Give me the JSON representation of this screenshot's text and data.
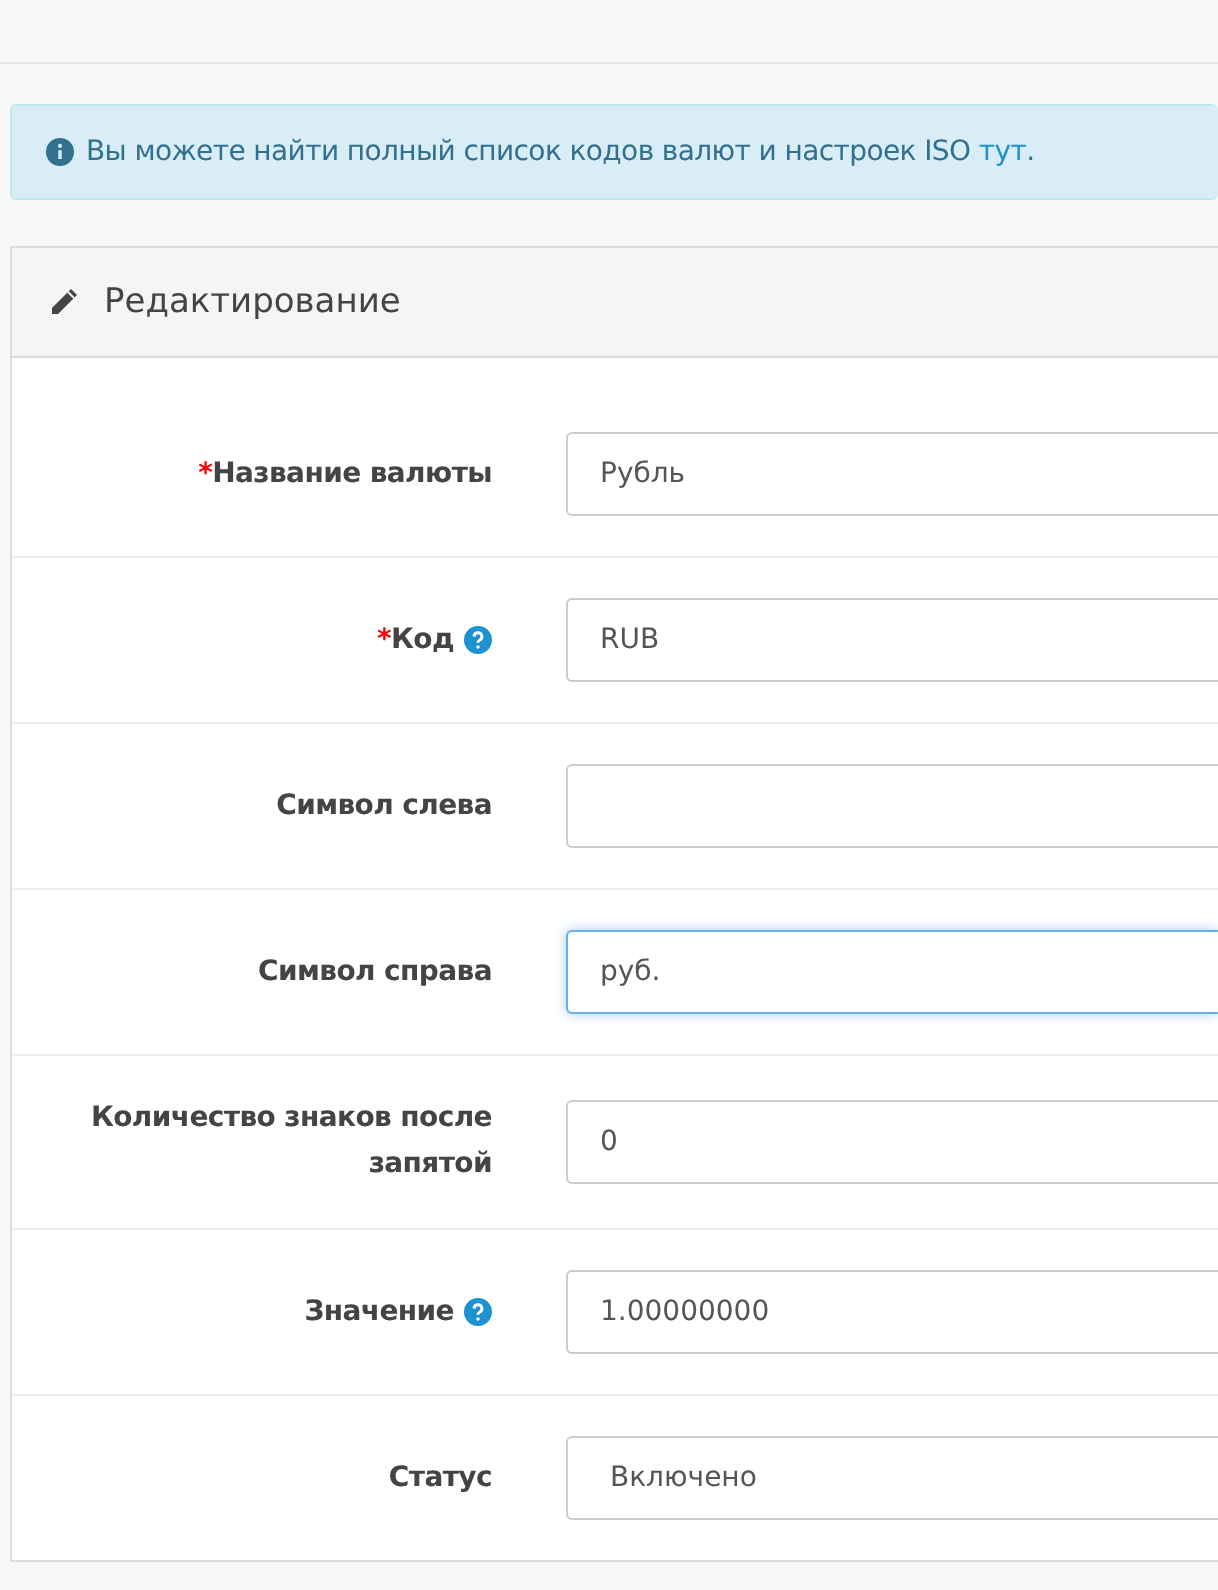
{
  "alert": {
    "text": "Вы можете найти полный список кодов валют и настроек ISO ",
    "link": "тут",
    "end": "."
  },
  "panel": {
    "title": "Редактирование"
  },
  "fields": [
    {
      "label": "Название валюты",
      "required_mark": "*",
      "help": false,
      "kind": "text",
      "value": "Рубль",
      "focused": false
    },
    {
      "label": "Код",
      "required_mark": "*",
      "help": true,
      "kind": "text",
      "value": "RUB",
      "focused": false
    },
    {
      "label": "Символ слева",
      "help": false,
      "kind": "text",
      "focused": false
    },
    {
      "label": "Символ справа",
      "help": false,
      "kind": "text",
      "value": "руб.",
      "focused": true
    },
    {
      "label": "Количество знаков после запятой",
      "help": false,
      "kind": "text",
      "value": "0",
      "focused": false
    },
    {
      "label": "Значение",
      "help": true,
      "kind": "text",
      "value": "1.00000000",
      "focused": false
    },
    {
      "label": "Статус",
      "help": false,
      "kind": "select",
      "value": "Включено",
      "focused": false
    }
  ]
}
